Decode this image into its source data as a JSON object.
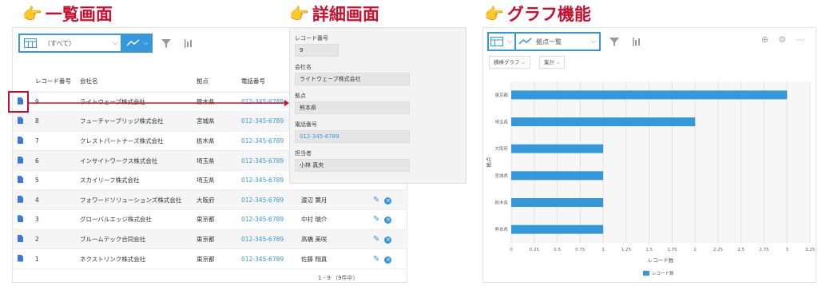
{
  "headings": {
    "list": "一覧画面",
    "detail": "詳細画面",
    "graph": "グラフ機能"
  },
  "list_view": {
    "view_label": "（すべて）",
    "columns": [
      "レコード番号",
      "会社名",
      "拠点",
      "電話番号"
    ],
    "rows": [
      {
        "no": "9",
        "company": "ライトウェーブ株式会社",
        "base": "熊本県",
        "phone": "012-345-6789",
        "owner": ""
      },
      {
        "no": "8",
        "company": "フューチャーブリッジ株式会社",
        "base": "宮城県",
        "phone": "012-345-6789",
        "owner": ""
      },
      {
        "no": "7",
        "company": "クレストパートナーズ株式会社",
        "base": "栃木県",
        "phone": "012-345-6789",
        "owner": ""
      },
      {
        "no": "6",
        "company": "インサイトワークス株式会社",
        "base": "埼玉県",
        "phone": "012-345-6789",
        "owner": ""
      },
      {
        "no": "5",
        "company": "スカイリーフ株式会社",
        "base": "埼玉県",
        "phone": "012-345-6789",
        "owner": ""
      },
      {
        "no": "4",
        "company": "フォワードソリューションズ株式会社",
        "base": "大阪府",
        "phone": "012-345-6789",
        "owner": "渡辺 葉月"
      },
      {
        "no": "3",
        "company": "グローバルエッジ株式会社",
        "base": "東京都",
        "phone": "012-345-6789",
        "owner": "中村 瑞介"
      },
      {
        "no": "2",
        "company": "ブルームテック合同会社",
        "base": "東京都",
        "phone": "012-345-6789",
        "owner": "高橋 美咲"
      },
      {
        "no": "1",
        "company": "ネクストリンク株式会社",
        "base": "東京都",
        "phone": "012-345-6789",
        "owner": "佐藤 翔真"
      }
    ],
    "pagination": "1 - 9 （9件中）"
  },
  "detail_view": {
    "fields": [
      {
        "label": "レコード番号",
        "value": "9"
      },
      {
        "label": "会社名",
        "value": "ライトウェーブ株式会社"
      },
      {
        "label": "拠点",
        "value": "熊本県"
      },
      {
        "label": "電話番号",
        "value": "012-345-6789"
      },
      {
        "label": "担当者",
        "value": "小林 真央"
      }
    ]
  },
  "graph_view": {
    "view_label": "拠点一覧",
    "filters": [
      "横棒グラフ",
      "集計"
    ]
  },
  "chart_data": {
    "type": "bar",
    "orientation": "horizontal",
    "categories": [
      "東京都",
      "埼玉県",
      "大阪府",
      "宮城県",
      "栃木県",
      "熊本県"
    ],
    "series": [
      {
        "name": "レコード数",
        "values": [
          3,
          2,
          1,
          1,
          1,
          1
        ]
      }
    ],
    "xlabel": "レコード数",
    "ylabel": "拠点",
    "xlim": [
      0,
      3.25
    ],
    "xticks": [
      "0",
      "0.25",
      "0.5",
      "0.75",
      "1",
      "1.25",
      "1.5",
      "1.75",
      "2",
      "2.25",
      "2.5",
      "2.75",
      "3",
      "3.25"
    ],
    "legend": "bottom",
    "grid": true,
    "color": "#3498db"
  }
}
